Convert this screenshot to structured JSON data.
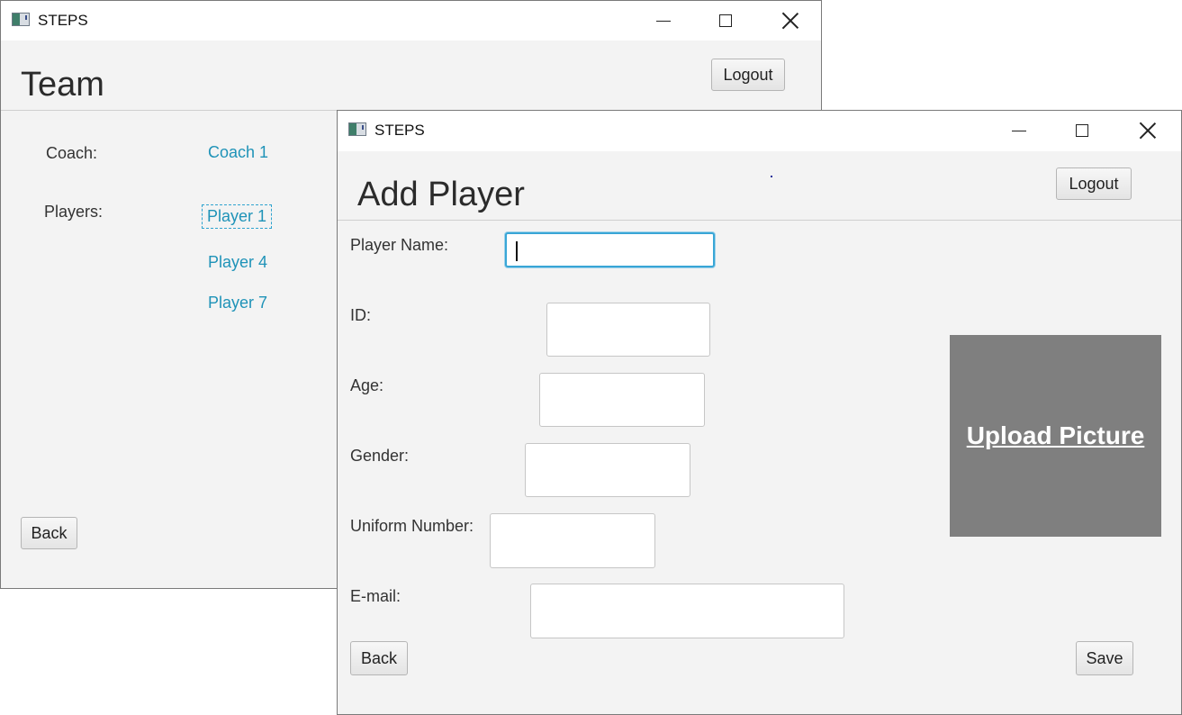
{
  "team_window": {
    "title": "STEPS",
    "heading": "Team",
    "logout_label": "Logout",
    "coach_label": "Coach:",
    "coach_name": "Coach 1",
    "players_label": "Players:",
    "players": [
      "Player 1",
      "Player 4",
      "Player 7"
    ],
    "back_label": "Back"
  },
  "add_player_window": {
    "title": "STEPS",
    "heading": "Add Player",
    "logout_label": "Logout",
    "fields": {
      "player_name_label": "Player Name:",
      "player_name_value": "",
      "id_label": "ID:",
      "id_value": "",
      "age_label": "Age:",
      "age_value": "",
      "gender_label": "Gender:",
      "gender_value": "",
      "uniform_label": "Uniform Number:",
      "uniform_value": "",
      "email_label": "E-mail:",
      "email_value": ""
    },
    "upload_label": "Upload Picture",
    "back_label": "Back",
    "save_label": "Save"
  },
  "colors": {
    "link": "#1f93b8",
    "focus": "#39a6d6",
    "upload_bg": "#7f7f7f",
    "window_bg": "#f3f3f3"
  },
  "icons": [
    "app-icon",
    "minimize-icon",
    "maximize-icon",
    "close-icon"
  ]
}
